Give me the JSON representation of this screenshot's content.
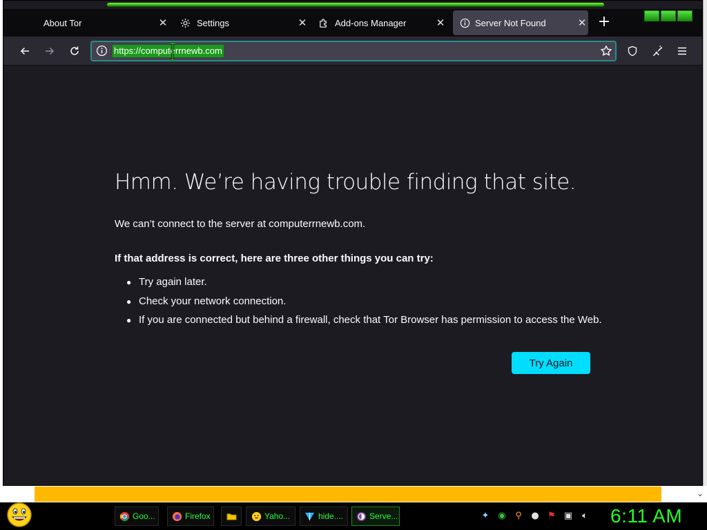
{
  "tabs": [
    {
      "label": "About Tor",
      "icon": "none"
    },
    {
      "label": "Settings",
      "icon": "gear-icon"
    },
    {
      "label": "Add-ons Manager",
      "icon": "puzzle-icon"
    },
    {
      "label": "Server Not Found",
      "icon": "info-icon"
    }
  ],
  "url_bar": {
    "value": "https://computerrnewb.com"
  },
  "error_page": {
    "title": "Hmm. We’re having trouble finding that site.",
    "description": "We can’t connect to the server at computerrnewb.com.",
    "try_heading": "If that address is correct, here are three other things you can try:",
    "suggestions": [
      "Try again later.",
      "Check your network connection.",
      "If you are connected but behind a firewall, check that Tor Browser has permission to access the Web."
    ],
    "try_again_label": "Try Again"
  },
  "taskbar": {
    "items": [
      {
        "label": "Goo...",
        "icon": "chrome-icon"
      },
      {
        "label": "Firefox",
        "icon": "firefox-icon"
      },
      {
        "label": "",
        "icon": "folder-icon"
      },
      {
        "label": "Yaho...",
        "icon": "yahoo-smiley-icon"
      },
      {
        "label": "hide....",
        "icon": "hide-icon"
      },
      {
        "label": "Serve...",
        "icon": "tor-icon"
      }
    ],
    "clock": "6:11 AM"
  },
  "colors": {
    "accent_green": "#22ff44",
    "button_cyan": "#00ddff",
    "page_bg": "#1c1b22",
    "banner_yellow": "#ffb800"
  }
}
